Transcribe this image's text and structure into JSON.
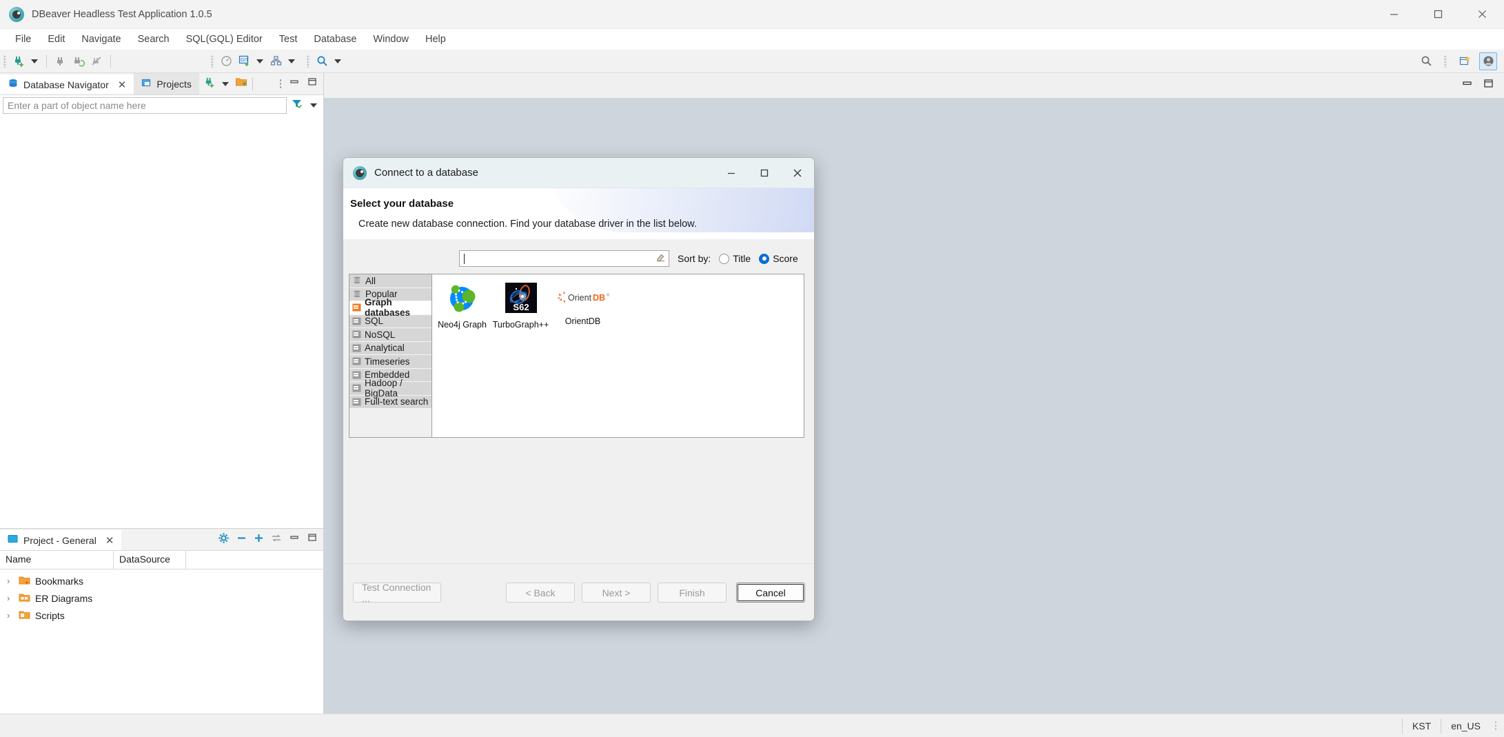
{
  "window": {
    "title": "DBeaver Headless Test Application 1.0.5",
    "app_icon": "dbeaver-icon",
    "controls": {
      "minimize": "minimize-icon",
      "maximize": "maximize-icon",
      "close": "close-icon"
    }
  },
  "menubar": {
    "items": [
      "File",
      "Edit",
      "Navigate",
      "Search",
      "SQL(GQL) Editor",
      "Test",
      "Database",
      "Window",
      "Help"
    ]
  },
  "toolbar": {
    "icons": [
      "new-connection-icon",
      "new-connection-dropdown",
      "connect-icon",
      "refresh-connection-icon",
      "disconnect-icon",
      "dashboard-icon",
      "git-icon",
      "git-dropdown",
      "commit-icon",
      "commit-dropdown",
      "search-icon",
      "search-dropdown"
    ],
    "right_icons": [
      "search-icon",
      "new-window-icon",
      "user-avatar-icon"
    ]
  },
  "navigator": {
    "tabs": [
      {
        "label": "Database Navigator",
        "icon": "database-navigator-icon",
        "active": true,
        "closable": true
      },
      {
        "label": "Projects",
        "icon": "projects-icon",
        "active": false,
        "closable": false
      }
    ],
    "tools": [
      "new-connection-icon",
      "new-connection-dropdown",
      "new-folder-icon"
    ],
    "view_menu": [
      "view-menu-icon",
      "minimize-view-icon",
      "maximize-view-icon"
    ],
    "filter": {
      "placeholder": "Enter a part of object name here",
      "value": "",
      "icons": [
        "filter-icon",
        "filter-dropdown-icon"
      ]
    }
  },
  "project_view": {
    "tab": {
      "label": "Project - General",
      "icon": "project-icon",
      "closable": true
    },
    "tools": [
      "configure-columns-icon",
      "collapse-all-icon",
      "expand-all-icon",
      "link-editor-icon",
      "minimize-view-icon",
      "maximize-view-icon"
    ],
    "columns": [
      "Name",
      "DataSource"
    ],
    "rows": [
      {
        "label": "Bookmarks",
        "icon": "bookmarks-folder-icon",
        "expanded": false,
        "datasource": ""
      },
      {
        "label": "ER Diagrams",
        "icon": "er-diagrams-folder-icon",
        "expanded": false,
        "datasource": ""
      },
      {
        "label": "Scripts",
        "icon": "scripts-folder-icon",
        "expanded": false,
        "datasource": ""
      }
    ]
  },
  "editor_area": {
    "controls": [
      "minimize-editor-icon",
      "maximize-editor-icon"
    ]
  },
  "dialog": {
    "title": "Connect to a database",
    "icon": "dbeaver-icon",
    "controls": {
      "minimize": "minimize-icon",
      "maximize": "maximize-icon",
      "close": "close-icon"
    },
    "heading": "Select your database",
    "description": "Create new database connection. Find your database driver in the list below.",
    "search": {
      "value": "",
      "placeholder": "",
      "clear_icon": "eraser-icon"
    },
    "sort": {
      "label": "Sort by:",
      "options": [
        {
          "label": "Title",
          "selected": false
        },
        {
          "label": "Score",
          "selected": true
        }
      ]
    },
    "categories": [
      {
        "label": "All",
        "icon": "database-stack-icon",
        "selected": false
      },
      {
        "label": "Popular",
        "icon": "database-stack-icon",
        "selected": false
      },
      {
        "label": "Graph databases",
        "icon": "graph-databases-icon",
        "selected": true
      },
      {
        "label": "SQL",
        "icon": "category-icon",
        "selected": false
      },
      {
        "label": "NoSQL",
        "icon": "category-icon",
        "selected": false
      },
      {
        "label": "Analytical",
        "icon": "category-icon",
        "selected": false
      },
      {
        "label": "Timeseries",
        "icon": "category-icon",
        "selected": false
      },
      {
        "label": "Embedded",
        "icon": "category-icon",
        "selected": false
      },
      {
        "label": "Hadoop / BigData",
        "icon": "category-icon",
        "selected": false
      },
      {
        "label": "Full-text search",
        "icon": "category-icon",
        "selected": false
      }
    ],
    "drivers": [
      {
        "label": "Neo4j Graph",
        "icon": "neo4j-logo"
      },
      {
        "label": "TurboGraph++",
        "icon": "turbograph-logo"
      },
      {
        "label": "OrientDB",
        "icon": "orientdb-logo"
      }
    ],
    "buttons": [
      {
        "label": "Test Connection ...",
        "enabled": false,
        "focused": false
      },
      {
        "label": "< Back",
        "enabled": false,
        "focused": false
      },
      {
        "label": "Next >",
        "enabled": false,
        "focused": false
      },
      {
        "label": "Finish",
        "enabled": false,
        "focused": false
      },
      {
        "label": "Cancel",
        "enabled": true,
        "focused": true
      }
    ]
  },
  "statusbar": {
    "cells": [
      "KST",
      "en_US"
    ]
  },
  "colors": {
    "accent": "#0a6ed1",
    "orange": "#f47b20",
    "neo4j_blue": "#018bff",
    "neo4j_green": "#5db52a",
    "dialog_title_bg": "#eaf1f3"
  }
}
